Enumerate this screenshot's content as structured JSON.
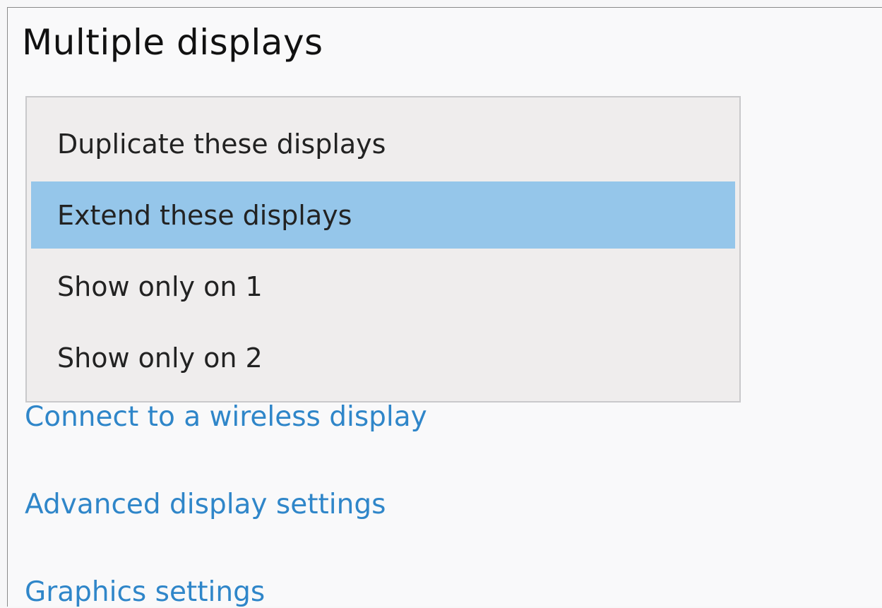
{
  "section": {
    "title": "Multiple displays"
  },
  "dropdown": {
    "selected": "Extend these displays",
    "options": [
      {
        "label": "Duplicate these displays",
        "selected": false
      },
      {
        "label": "Extend these displays",
        "selected": true
      },
      {
        "label": "Show only on 1",
        "selected": false
      },
      {
        "label": "Show only on 2",
        "selected": false
      }
    ]
  },
  "links": {
    "wireless": "Connect to a wireless display",
    "advanced": "Advanced display settings",
    "graphics": "Graphics settings"
  },
  "colors": {
    "selection_highlight": "#95c6ea",
    "link": "#2f86c9",
    "dropdown_background": "#efeded"
  }
}
